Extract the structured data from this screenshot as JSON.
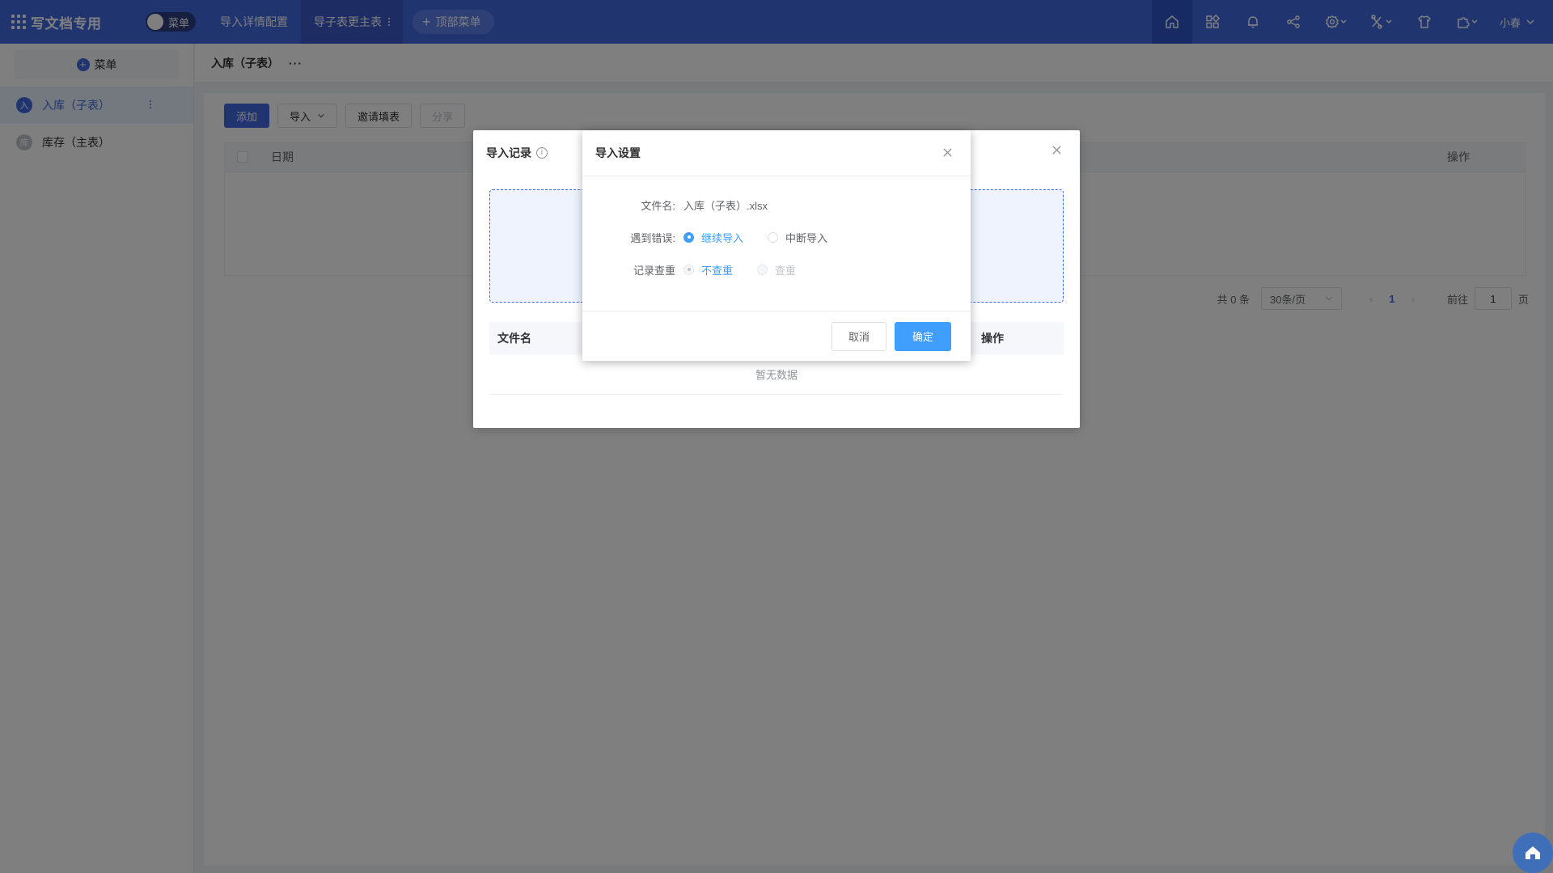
{
  "app": {
    "title": "写文档专用",
    "menu_toggle_label": "菜单"
  },
  "topnav": {
    "items": [
      {
        "label": "导入详情配置"
      },
      {
        "label": "导子表更主表"
      }
    ],
    "add_top_menu_label": "顶部菜单",
    "user_name": "小春"
  },
  "sidebar": {
    "add_menu_label": "菜单",
    "items": [
      {
        "badge": "入",
        "label": "入库（子表）"
      },
      {
        "badge": "库",
        "label": "库存（主表）"
      }
    ]
  },
  "main": {
    "breadcrumb": "入库（子表）",
    "more": "···",
    "toolbar": {
      "add": "添加",
      "import": "导入",
      "invite": "邀请填表",
      "share": "分享"
    },
    "table": {
      "columns": [
        "日期",
        "操作"
      ]
    },
    "pager": {
      "total": "共 0 条",
      "page_size": "30条/页",
      "current_page": "1",
      "goto_label": "前往",
      "goto_value": "1",
      "page_suffix": "页"
    }
  },
  "record_dialog": {
    "title": "导入记录",
    "columns": [
      "文件名",
      "操作"
    ],
    "empty_text": "暂无数据"
  },
  "settings_dialog": {
    "title": "导入设置",
    "file_label": "文件名:",
    "file_name": "入库（子表）.xlsx",
    "error_label": "遇到错误:",
    "error_options": [
      "继续导入",
      "中断导入"
    ],
    "dedupe_label": "记录查重",
    "dedupe_options": [
      "不查重",
      "查重"
    ],
    "cancel": "取消",
    "confirm": "确定"
  },
  "colors": {
    "topbar": "#4169e1",
    "primary": "#409eff"
  }
}
